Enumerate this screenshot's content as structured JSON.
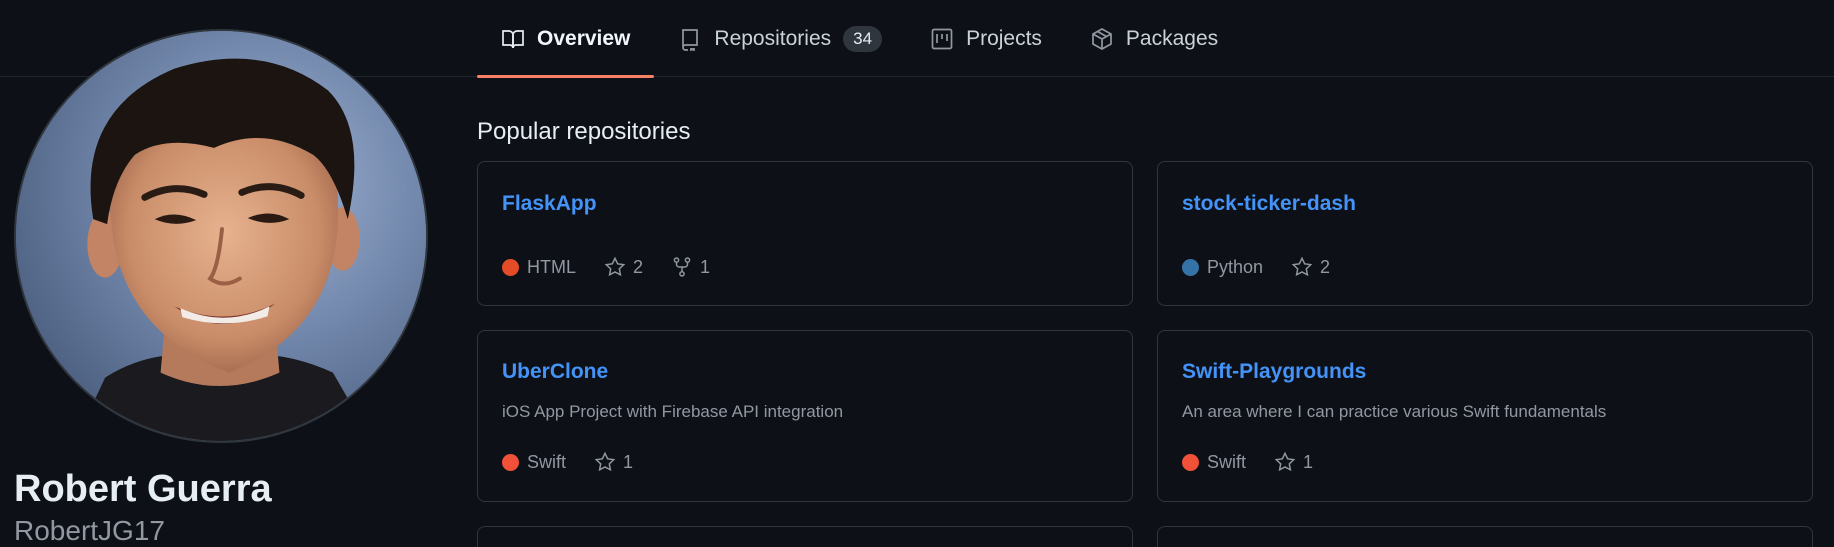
{
  "tabs": [
    {
      "label": "Overview",
      "icon": "book-icon",
      "active": true
    },
    {
      "label": "Repositories",
      "icon": "repo-icon",
      "count": "34"
    },
    {
      "label": "Projects",
      "icon": "project-icon"
    },
    {
      "label": "Packages",
      "icon": "package-icon"
    }
  ],
  "profile": {
    "full_name": "Robert Guerra",
    "username": "RobertJG17"
  },
  "popular": {
    "title": "Popular repositories",
    "repos": [
      {
        "name": "FlaskApp",
        "description": "",
        "language": "HTML",
        "language_color": "#e34c26",
        "stars": "2",
        "forks": "1"
      },
      {
        "name": "stock-ticker-dash",
        "description": "",
        "language": "Python",
        "language_color": "#3572A5",
        "stars": "2"
      },
      {
        "name": "UberClone",
        "description": "iOS App Project with Firebase API integration",
        "language": "Swift",
        "language_color": "#F05138",
        "stars": "1"
      },
      {
        "name": "Swift-Playgrounds",
        "description": "An area where I can practice various Swift fundamentals",
        "language": "Swift",
        "language_color": "#F05138",
        "stars": "1"
      }
    ]
  },
  "colors": {
    "background": "#0d1117",
    "border": "#30363d",
    "link": "#4493f8",
    "active_tab_underline": "#f78166"
  }
}
